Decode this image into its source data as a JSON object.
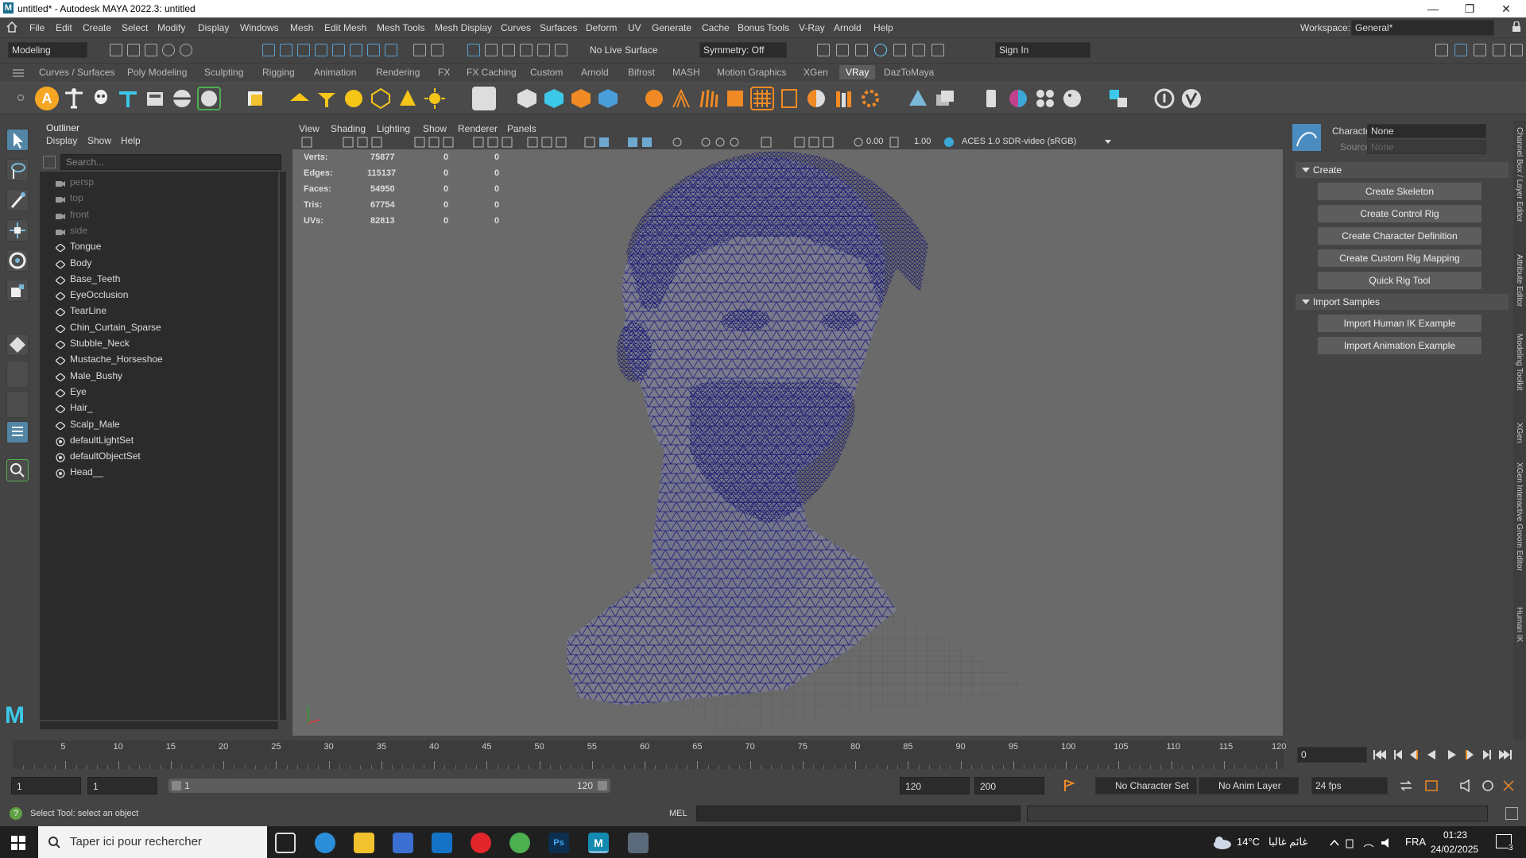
{
  "title_bar": {
    "title": "untitled* - Autodesk MAYA 2022.3: untitled",
    "logo": "M"
  },
  "menu": [
    "File",
    "Edit",
    "Create",
    "Select",
    "Modify",
    "Display",
    "Windows",
    "Mesh",
    "Edit Mesh",
    "Mesh Tools",
    "Mesh Display",
    "Curves",
    "Surfaces",
    "Deform",
    "UV",
    "Generate",
    "Cache",
    "Bonus Tools",
    "V-Ray",
    "Arnold",
    "Help"
  ],
  "workspace": {
    "label": "Workspace:",
    "value": "General*"
  },
  "status_line": {
    "mode": "Modeling",
    "live_surface": "No Live Surface",
    "symmetry": "Symmetry: Off",
    "sign_in": "Sign In"
  },
  "shelf_tabs": [
    "Curves / Surfaces",
    "Poly Modeling",
    "Sculpting",
    "Rigging",
    "Animation",
    "Rendering",
    "FX",
    "FX Caching",
    "Custom",
    "Arnold",
    "Bifrost",
    "MASH",
    "Motion Graphics",
    "XGen",
    "VRay",
    "DazToMaya"
  ],
  "active_shelf": "VRay",
  "outliner": {
    "title": "Outliner",
    "menu": [
      "Display",
      "Show",
      "Help"
    ],
    "search_placeholder": "Search...",
    "items": [
      {
        "label": "persp",
        "type": "camera"
      },
      {
        "label": "top",
        "type": "camera"
      },
      {
        "label": "front",
        "type": "camera"
      },
      {
        "label": "side",
        "type": "camera"
      },
      {
        "label": "Tongue",
        "type": "mesh"
      },
      {
        "label": "Body",
        "type": "mesh"
      },
      {
        "label": "Base_Teeth",
        "type": "mesh"
      },
      {
        "label": "EyeOcclusion",
        "type": "mesh"
      },
      {
        "label": "TearLine",
        "type": "mesh"
      },
      {
        "label": "Chin_Curtain_Sparse",
        "type": "mesh"
      },
      {
        "label": "Stubble_Neck",
        "type": "mesh"
      },
      {
        "label": "Mustache_Horseshoe",
        "type": "mesh"
      },
      {
        "label": "Male_Bushy",
        "type": "mesh"
      },
      {
        "label": "Eye",
        "type": "mesh"
      },
      {
        "label": "Hair_",
        "type": "mesh"
      },
      {
        "label": "Scalp_Male",
        "type": "mesh"
      },
      {
        "label": "defaultLightSet",
        "type": "set"
      },
      {
        "label": "defaultObjectSet",
        "type": "set"
      },
      {
        "label": "Head__",
        "type": "set"
      }
    ]
  },
  "viewport": {
    "menu": [
      "View",
      "Shading",
      "Lighting",
      "Show",
      "Renderer",
      "Panels"
    ],
    "exposure": "0.00",
    "gamma": "1.00",
    "color_space": "ACES 1.0 SDR-video (sRGB)",
    "hud": [
      {
        "label": "Verts:",
        "values": [
          "75877",
          "0",
          "0"
        ]
      },
      {
        "label": "Edges:",
        "values": [
          "115137",
          "0",
          "0"
        ]
      },
      {
        "label": "Faces:",
        "values": [
          "54950",
          "0",
          "0"
        ]
      },
      {
        "label": "Tris:",
        "values": [
          "67754",
          "0",
          "0"
        ]
      },
      {
        "label": "UVs:",
        "values": [
          "82813",
          "0",
          "0"
        ]
      }
    ]
  },
  "hik": {
    "character_label": "Character:",
    "character_value": "None",
    "source_label": "Source:",
    "source_value": "None",
    "create_section": "Create",
    "create_buttons": [
      "Create Skeleton",
      "Create Control Rig",
      "Create Character Definition",
      "Create Custom Rig Mapping",
      "Quick Rig Tool"
    ],
    "import_section": "Import Samples",
    "import_buttons": [
      "Import Human IK Example",
      "Import Animation Example"
    ]
  },
  "side_tabs": [
    "Channel Box / Layer Editor",
    "Attribute Editor",
    "Modeling Toolkit",
    "XGen",
    "XGen Interactive Groom Editor",
    "Human IK"
  ],
  "timeline": {
    "ticks": [
      "5",
      "10",
      "15",
      "20",
      "25",
      "30",
      "35",
      "40",
      "45",
      "50",
      "55",
      "60",
      "65",
      "70",
      "75",
      "80",
      "85",
      "90",
      "95",
      "100",
      "105",
      "110",
      "115",
      "120"
    ],
    "current_frame": "0"
  },
  "range": {
    "start": "1",
    "start2": "1",
    "slider_start": "1",
    "slider_end": "120",
    "end": "120",
    "end2": "200",
    "character_set": "No Character Set",
    "anim_layer": "No Anim Layer",
    "fps": "24 fps"
  },
  "command": {
    "help": "Select Tool: select an object",
    "lang": "MEL"
  },
  "taskbar": {
    "search": "Taper ici pour rechercher",
    "weather": "14°C",
    "weather_text": "غائم غالبا",
    "lang": "FRA",
    "time": "01:23",
    "date": "24/02/2025",
    "notif": "3"
  },
  "colors": {
    "accent": "#5285a6",
    "wire": "#1c1c7a",
    "panel": "#444444",
    "field": "#2b2b2b"
  }
}
